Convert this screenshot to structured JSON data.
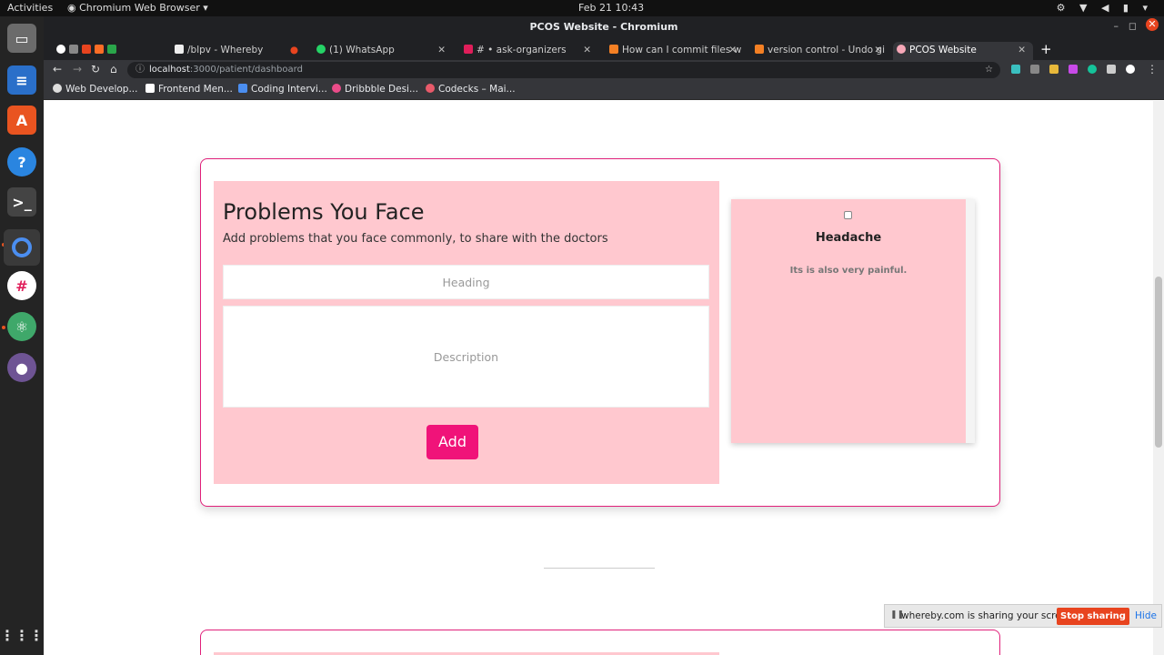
{
  "topbar": {
    "activities": "Activities",
    "app_menu": "Chromium Web Browser ▾",
    "clock": "Feb 21  10:43"
  },
  "window": {
    "title": "PCOS Website - Chromium"
  },
  "tabs": [
    {
      "label": "/blpv - Whereby"
    },
    {
      "label": "(1) WhatsApp"
    },
    {
      "label": "# • ask-organizers"
    },
    {
      "label": "How can I commit files w"
    },
    {
      "label": "version control - Undo gi"
    },
    {
      "label": "PCOS Website"
    }
  ],
  "address_bar": {
    "host": "localhost",
    "path": ":3000/patient/dashboard"
  },
  "bookmarks": [
    {
      "label": "Web Develop..."
    },
    {
      "label": "Frontend Men..."
    },
    {
      "label": "Coding Intervi..."
    },
    {
      "label": "Dribbble Desi..."
    },
    {
      "label": "Codecks – Mai..."
    }
  ],
  "form": {
    "title": "Problems You Face",
    "subtitle": "Add problems that you face commonly, to share with the doctors",
    "heading_placeholder": "Heading",
    "description_placeholder": "Description",
    "add_label": "Add"
  },
  "problems": [
    {
      "title": "Headache",
      "description": "Its is also very painful."
    }
  ],
  "share_bar": {
    "message": "whereby.com is sharing your screen.",
    "stop_label": "Stop sharing",
    "hide_label": "Hide"
  },
  "colors": {
    "accent": "#f01379",
    "panel": "#ffc8cf",
    "border": "#e0207a"
  }
}
